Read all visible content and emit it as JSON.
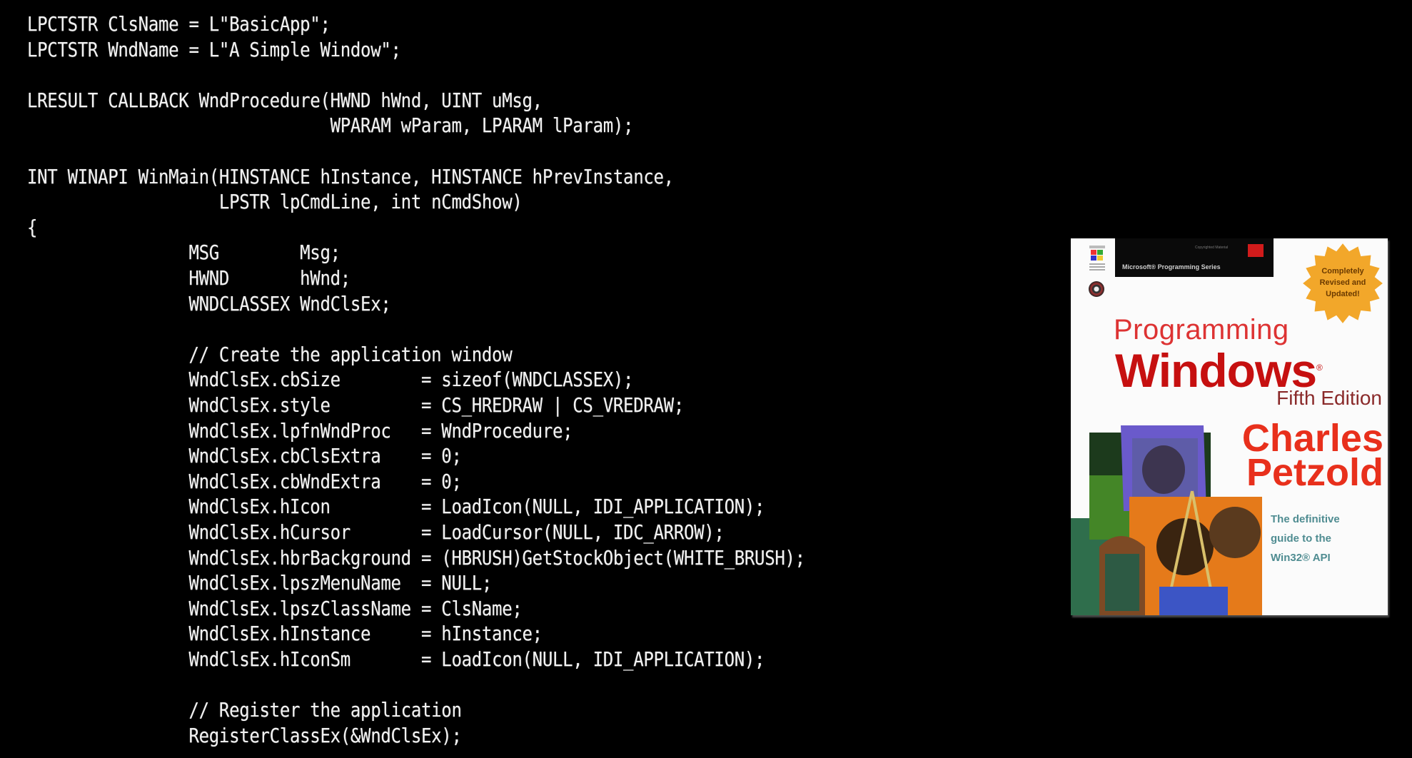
{
  "code": {
    "lines": [
      "LPCTSTR ClsName = L\"BasicApp\";",
      "LPCTSTR WndName = L\"A Simple Window\";",
      "",
      "LRESULT CALLBACK WndProcedure(HWND hWnd, UINT uMsg,",
      "                              WPARAM wParam, LPARAM lParam);",
      "",
      "INT WINAPI WinMain(HINSTANCE hInstance, HINSTANCE hPrevInstance,",
      "                   LPSTR lpCmdLine, int nCmdShow)",
      "{",
      "                MSG        Msg;",
      "                HWND       hWnd;",
      "                WNDCLASSEX WndClsEx;",
      "",
      "                // Create the application window",
      "                WndClsEx.cbSize        = sizeof(WNDCLASSEX);",
      "                WndClsEx.style         = CS_HREDRAW | CS_VREDRAW;",
      "                WndClsEx.lpfnWndProc   = WndProcedure;",
      "                WndClsEx.cbClsExtra    = 0;",
      "                WndClsEx.cbWndExtra    = 0;",
      "                WndClsEx.hIcon         = LoadIcon(NULL, IDI_APPLICATION);",
      "                WndClsEx.hCursor       = LoadCursor(NULL, IDC_ARROW);",
      "                WndClsEx.hbrBackground = (HBRUSH)GetStockObject(WHITE_BRUSH);",
      "                WndClsEx.lpszMenuName  = NULL;",
      "                WndClsEx.lpszClassName = ClsName;",
      "                WndClsEx.hInstance     = hInstance;",
      "                WndClsEx.hIconSm       = LoadIcon(NULL, IDI_APPLICATION);",
      "",
      "                // Register the application",
      "                RegisterClassEx(&WndClsEx);"
    ]
  },
  "book_cover": {
    "series": "Microsoft® Programming Series",
    "copyright_note": "Copyrighted Material",
    "badge": [
      "Completely",
      "Revised and",
      "Updated!"
    ],
    "title_line1": "Programming",
    "title_line2": "Windows",
    "registered_mark": "®",
    "edition": "Fifth Edition",
    "author_first": "Charles",
    "author_last": "Petzold",
    "tagline": [
      "The definitive",
      "guide to the",
      "Win32® API"
    ],
    "colors": {
      "title": "#c61010",
      "author": "#e8301c",
      "tagline": "#4f8c91",
      "badge": "#f2a72a"
    }
  }
}
